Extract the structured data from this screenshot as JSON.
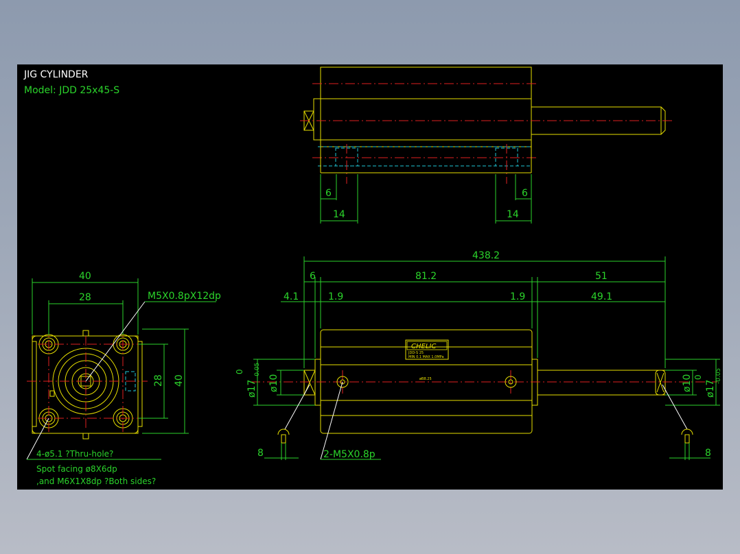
{
  "title": "JIG CYLINDER",
  "model": "Model:  JDD 25x45-S",
  "top_view": {
    "dim_left_small": "6",
    "dim_right_small": "6",
    "dim_left_big": "14",
    "dim_right_big": "14"
  },
  "side_view": {
    "overall": "438.2",
    "d_left": "6",
    "d_middle": "81.2",
    "d_right": "51",
    "d_41": "4.1",
    "d_19a": "1.9",
    "d_19b": "1.9",
    "d_491": "49.1",
    "dia10_left": "ø10",
    "dia17_left": "ø17",
    "dia10_right": "ø10",
    "dia17_right": "ø17",
    "tol_top": "0",
    "tol_bottom": "-0.05",
    "tap_note": "2-M5X0.8p",
    "pin_left": "8",
    "pin_right": "8",
    "bore_label": "øB8.25",
    "nameplate_brand": "CHELIC",
    "nameplate_line1": "JDD-S 25",
    "nameplate_line2": "MIN 0.1 MAX 1.0MPa"
  },
  "end_view": {
    "width_40": "40",
    "width_28": "28",
    "height_28": "28",
    "height_40": "40",
    "port_note": "M5X0.8pX12dp",
    "hole_note": "4-ø5.1 ?Thru-hole?",
    "spot_note": "Spot facing  ø8X6dp",
    "and_note": ",and  M6X1X8dp ?Both sides?"
  },
  "colors": {
    "outline": "#e8e000",
    "dimension": "#2bd42b",
    "center": "#e02020",
    "hidden": "#20c8d8",
    "background": "#000000"
  }
}
